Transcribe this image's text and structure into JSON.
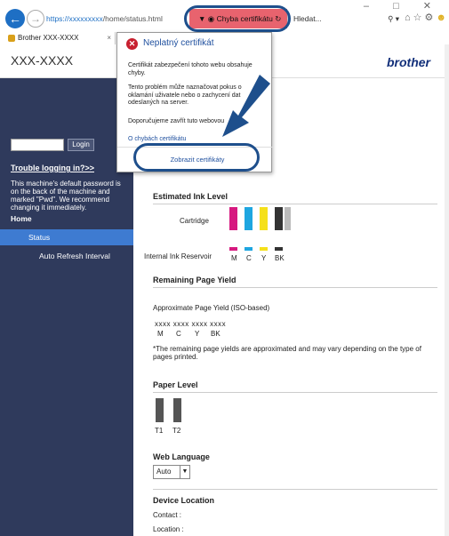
{
  "browser": {
    "url": "https://xxxxxxxxx/home/status.html",
    "url_blue_part": "https://xxxxxxxxx",
    "cert_error_label": "Chyba certifikátu",
    "search_placeholder": "Hledat...",
    "tab_title": "Brother XXX-XXXX",
    "tab_close": "×",
    "back_icon": "arrow-left",
    "window_controls": "–  □  ✕"
  },
  "header": {
    "model": "XXX-XXXX",
    "brand": "brother"
  },
  "sidebar": {
    "login_button": "Login",
    "trouble_link": "Trouble logging in?>>",
    "password_note": "This machine's default password is on the back of the machine and marked \"Pwd\". We recommend changing it immediately.",
    "nav": {
      "home": "Home",
      "status": "Status",
      "auto_refresh": "Auto Refresh Interval"
    }
  },
  "cert_popup": {
    "title": "Neplatný certifikát",
    "text1": "Certifikát zabezpečení tohoto webu obsahuje chyby.",
    "text2": "Tento problém může naznačovat pokus o oklamání uživatele nebo o zachycení dat odeslaných na server.",
    "text3": "Doporučujeme zavřít tuto webovou",
    "link": "O chybách certifikátu",
    "view_button": "Zobrazit certifikáty"
  },
  "main": {
    "ink": {
      "title": "Estimated Ink Level",
      "cartridge_label": "Cartridge",
      "reservoir_label": "Internal Ink Reservoir",
      "colors": [
        "M",
        "C",
        "Y",
        "BK"
      ],
      "color_hex": [
        "#d6197f",
        "#1ea6e0",
        "#f5e01a",
        "#333333"
      ]
    },
    "yield": {
      "title": "Remaining Page Yield",
      "subtitle": "Approximate Page Yield (ISO-based)",
      "values": "xxxx  xxxx  xxxx  xxxx",
      "labels": [
        "M",
        "C",
        "Y",
        "BK"
      ],
      "note": "*The remaining page yields are approximated and may vary depending on the type of pages printed."
    },
    "paper": {
      "title": "Paper Level",
      "trays": [
        "T1",
        "T2"
      ]
    },
    "language": {
      "title": "Web Language",
      "selected": "Auto"
    },
    "location": {
      "title": "Device Location",
      "contact": "Contact :",
      "location": "Location :"
    }
  }
}
